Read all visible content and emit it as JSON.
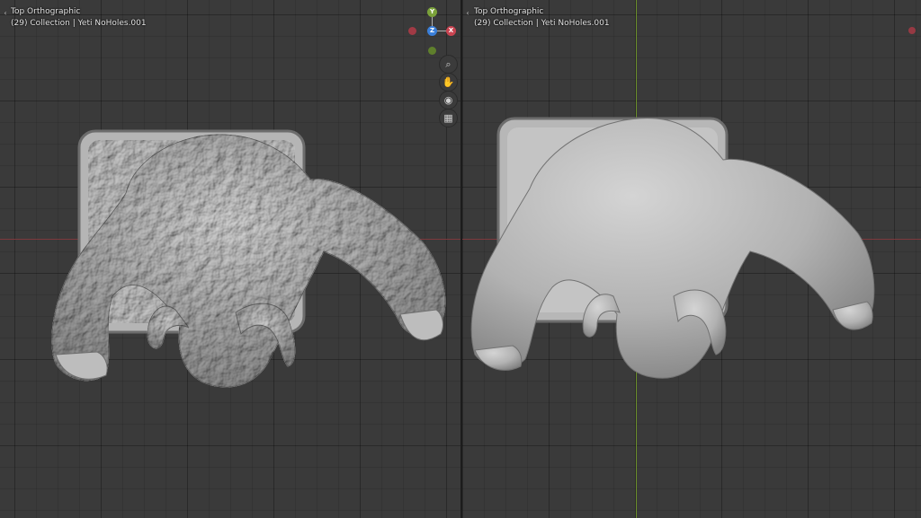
{
  "left_viewport": {
    "view_label": "Top Orthographic",
    "object_label": "(29) Collection | Yeti NoHoles.001"
  },
  "right_viewport": {
    "view_label": "Top Orthographic",
    "object_label": "(29) Collection | Yeti NoHoles.001"
  },
  "gizmo": {
    "y_label": "Y",
    "z_label": "Z",
    "x_label": "X"
  },
  "nav_icons": [
    "zoom-icon",
    "hand-pan-icon",
    "camera-icon",
    "grid-icon"
  ],
  "colors": {
    "background": "#3a3a3a",
    "x_axis": "#b34a55",
    "y_axis": "#7ba23a",
    "z_axis": "#3a7fd9",
    "mesh": "#b8b8b8"
  }
}
